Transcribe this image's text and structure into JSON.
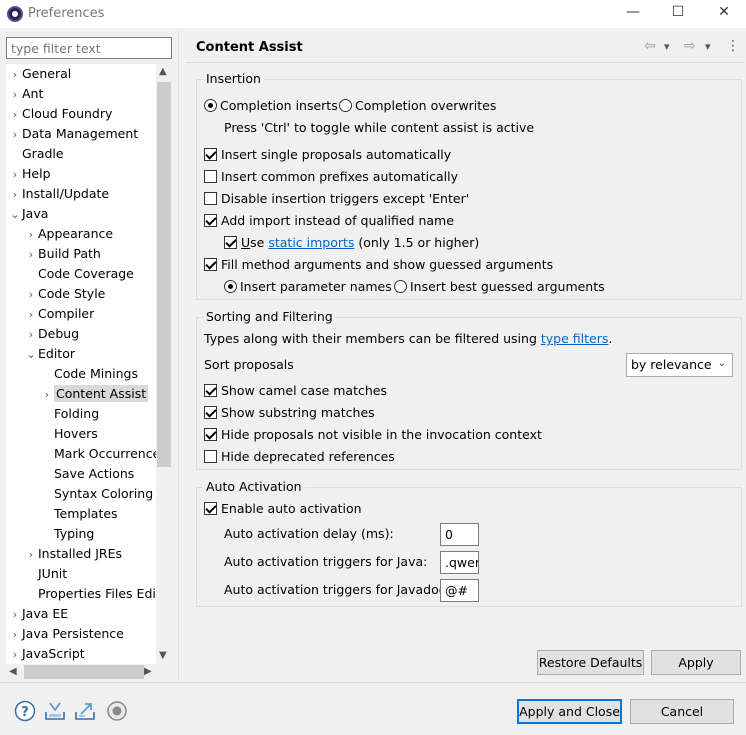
{
  "window": {
    "title": "Preferences",
    "minimize": "—",
    "maximize": "☐",
    "close": "✕"
  },
  "filter": {
    "placeholder": "type filter text"
  },
  "tree": {
    "items": [
      {
        "label": "General",
        "arrow": "›"
      },
      {
        "label": "Ant",
        "arrow": "›"
      },
      {
        "label": "Cloud Foundry",
        "arrow": "›"
      },
      {
        "label": "Data Management",
        "arrow": "›"
      },
      {
        "label": "Gradle",
        "arrow": ""
      },
      {
        "label": "Help",
        "arrow": "›"
      },
      {
        "label": "Install/Update",
        "arrow": "›"
      },
      {
        "label": "Java",
        "arrow": "⌄"
      },
      {
        "label": "Appearance",
        "arrow": "›"
      },
      {
        "label": "Build Path",
        "arrow": "›"
      },
      {
        "label": "Code Coverage",
        "arrow": ""
      },
      {
        "label": "Code Style",
        "arrow": "›"
      },
      {
        "label": "Compiler",
        "arrow": "›"
      },
      {
        "label": "Debug",
        "arrow": "›"
      },
      {
        "label": "Editor",
        "arrow": "⌄"
      },
      {
        "label": "Code Minings",
        "arrow": ""
      },
      {
        "label": "Content Assist",
        "arrow": "›"
      },
      {
        "label": "Folding",
        "arrow": ""
      },
      {
        "label": "Hovers",
        "arrow": ""
      },
      {
        "label": "Mark Occurrence",
        "arrow": ""
      },
      {
        "label": "Save Actions",
        "arrow": ""
      },
      {
        "label": "Syntax Coloring",
        "arrow": ""
      },
      {
        "label": "Templates",
        "arrow": ""
      },
      {
        "label": "Typing",
        "arrow": ""
      },
      {
        "label": "Installed JREs",
        "arrow": "›"
      },
      {
        "label": "JUnit",
        "arrow": ""
      },
      {
        "label": "Properties Files Edit",
        "arrow": ""
      },
      {
        "label": "Java EE",
        "arrow": "›"
      },
      {
        "label": "Java Persistence",
        "arrow": "›"
      },
      {
        "label": "JavaScript",
        "arrow": "›"
      }
    ]
  },
  "page": {
    "title": "Content Assist",
    "nav_back": "⇦",
    "nav_back_menu": "▾",
    "nav_forward": "⇨",
    "nav_forward_menu": "▾",
    "menu": "⋮"
  },
  "insertion": {
    "label": "Insertion",
    "completion_inserts": "Completion inserts",
    "completion_overwrites": "Completion overwrites",
    "toggle_hint": "Press 'Ctrl' to toggle while content assist is active",
    "insert_single": "Insert single proposals automatically",
    "insert_common": "Insert common prefixes automatically",
    "disable_triggers": "Disable insertion triggers except 'Enter'",
    "add_import": "Add import instead of qualified name",
    "use_u": "U",
    "use_rest": "se",
    "static_imports": "static imports",
    "only_15": "(only 1.5 or higher)",
    "fill_method": "Fill method arguments and show guessed arguments",
    "insert_param_names": "Insert parameter names",
    "insert_best_guessed": "Insert best guessed arguments"
  },
  "sorting": {
    "label": "Sorting and Filtering",
    "types_text": "Types along with their members can be filtered using",
    "type_filters": "type filters",
    "period": ".",
    "sort_proposals": "Sort proposals",
    "sort_value": "by relevance",
    "camel_case": "Show camel case matches",
    "substring": "Show substring matches",
    "hide_not_visible": "Hide proposals not visible in the invocation context",
    "hide_deprecated": "Hide deprecated references"
  },
  "auto": {
    "label": "Auto Activation",
    "enable": "Enable auto activation",
    "delay_label": "Auto activation delay (ms):",
    "delay_value": "0",
    "java_triggers_label": "Auto activation triggers for Java:",
    "java_triggers_value": ".qwer",
    "javadoc_triggers_label": "Auto activation triggers for Javadoc:",
    "javadoc_triggers_value": "@#"
  },
  "buttons": {
    "restore_defaults": "Restore Defaults",
    "apply": "Apply",
    "apply_close": "Apply and Close",
    "cancel": "Cancel"
  },
  "icons": {
    "help": "help-icon",
    "import": "import-icon",
    "export": "export-icon",
    "record": "record-icon"
  },
  "colors": {
    "accent": "#0078d7",
    "link": "#0066cc"
  }
}
